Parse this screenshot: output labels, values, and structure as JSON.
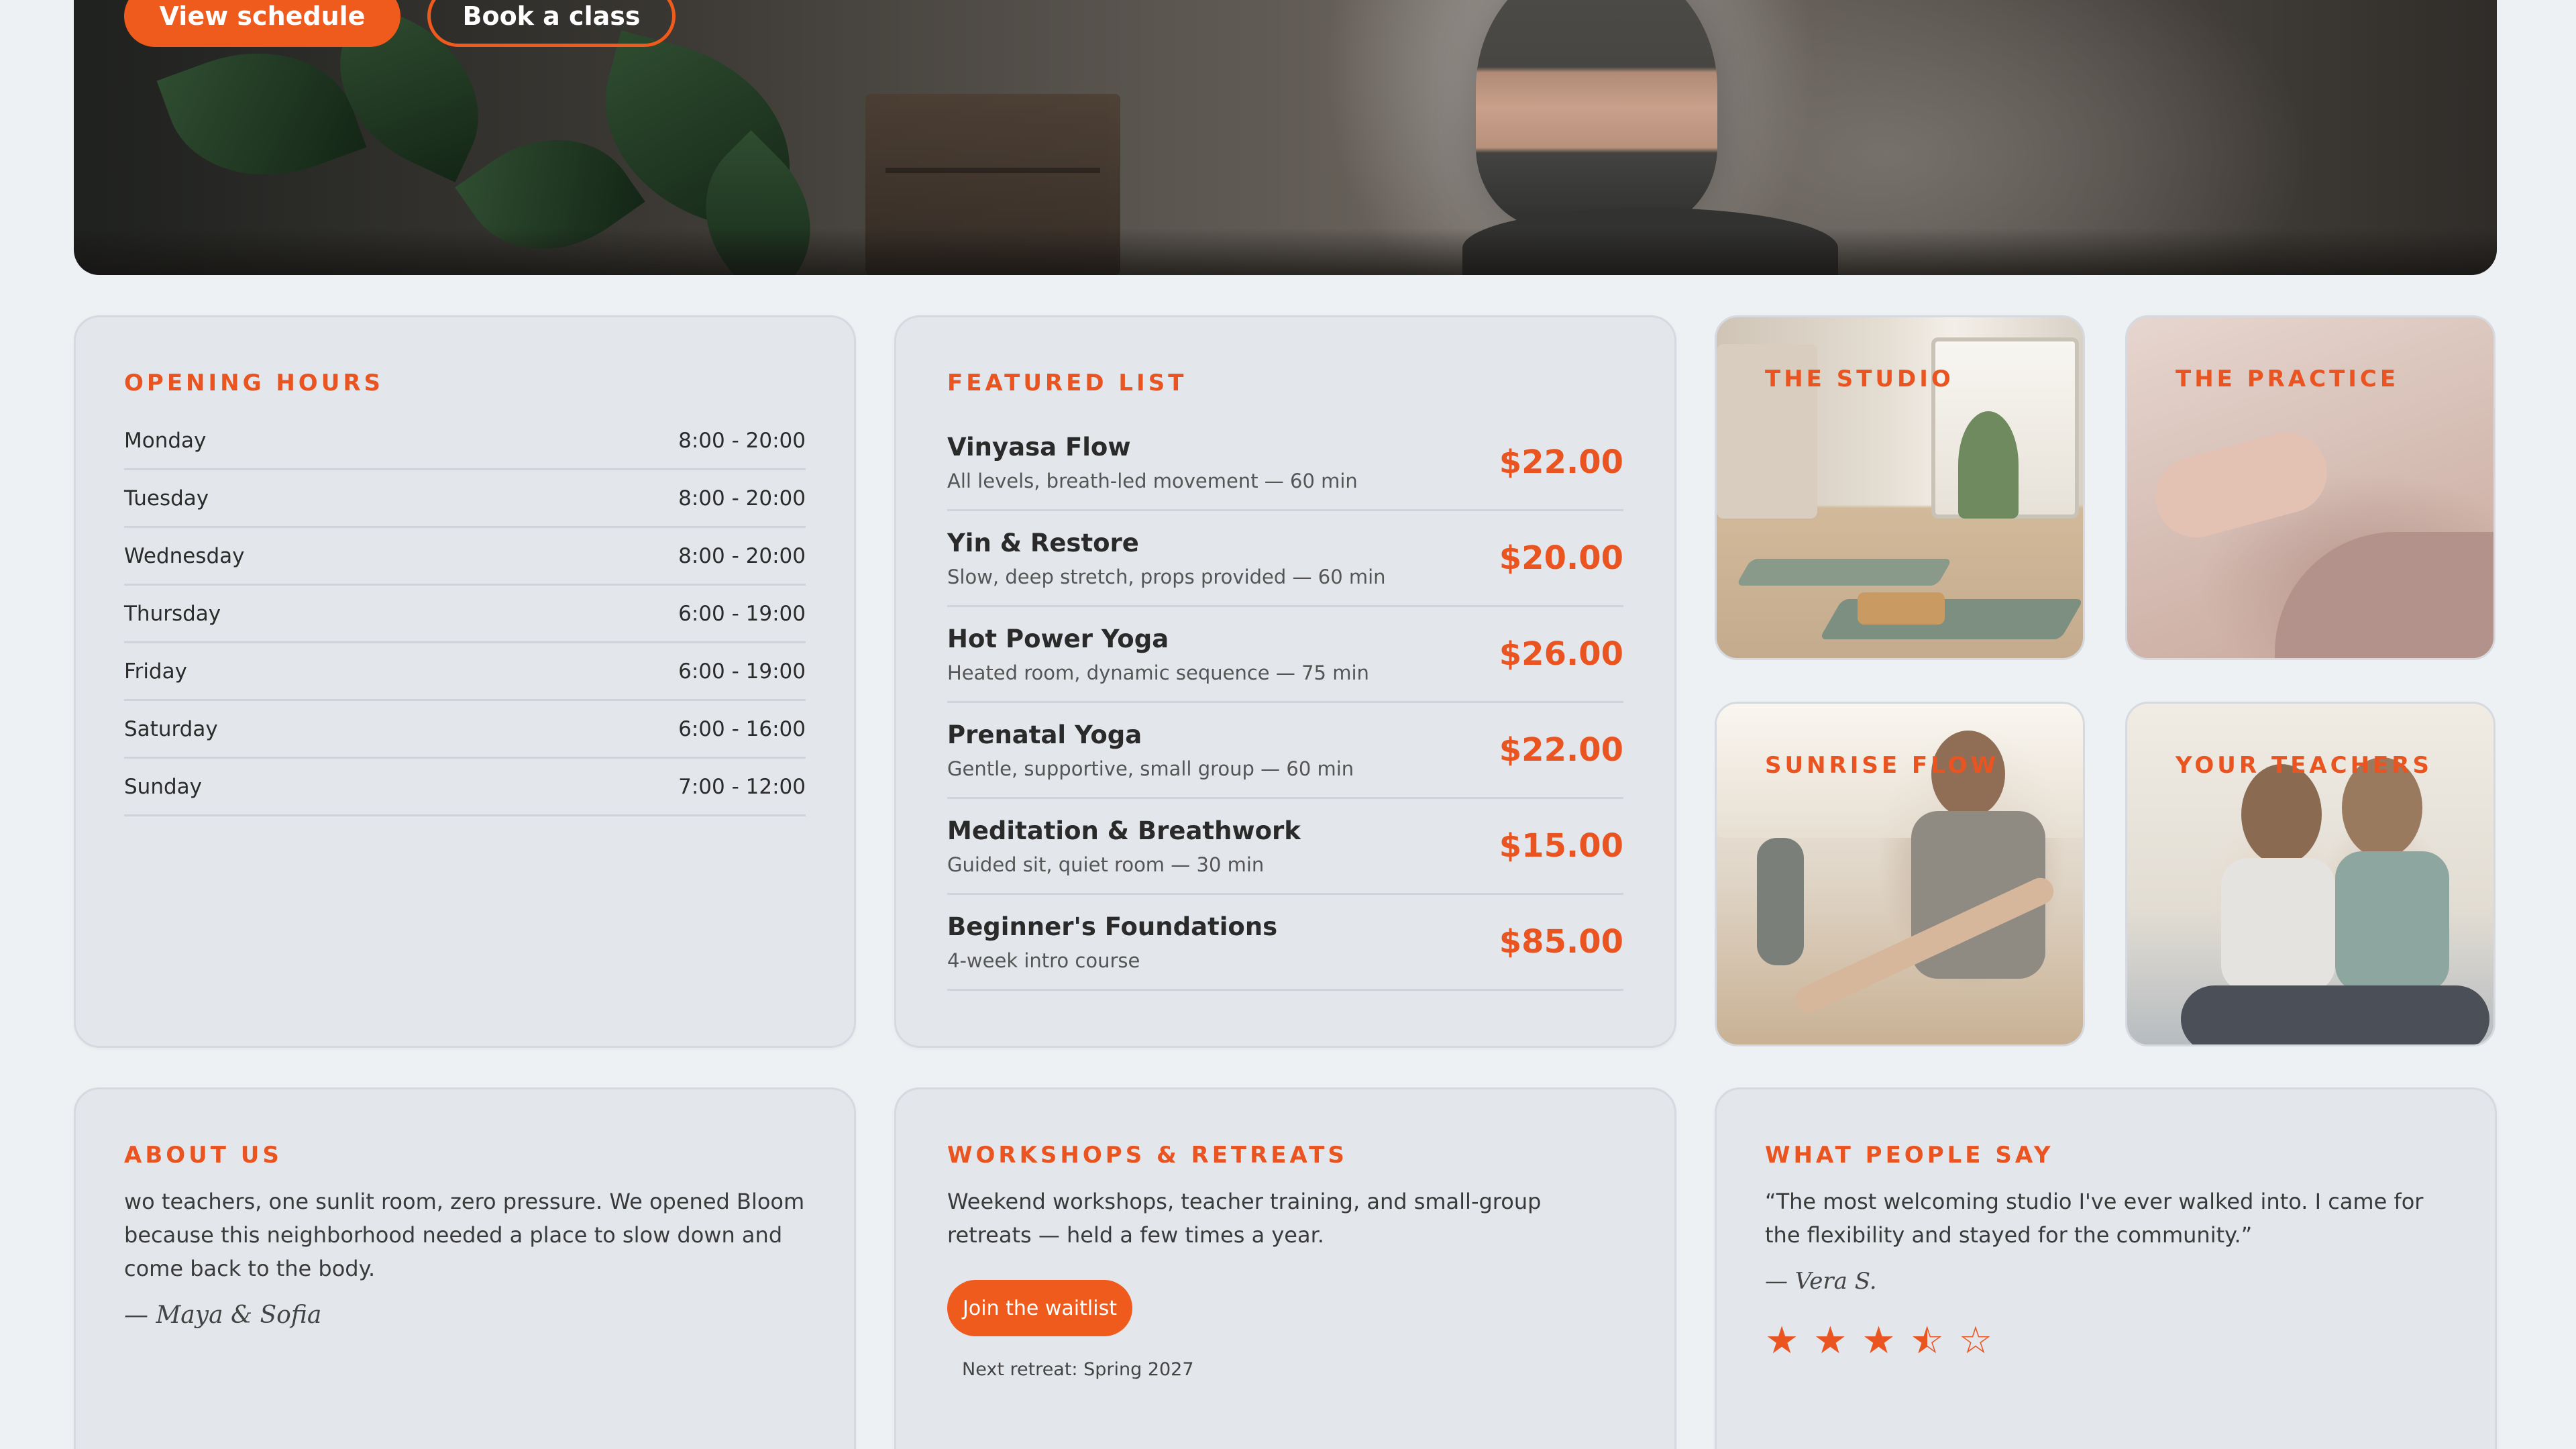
{
  "hero": {
    "primary_button": "View schedule",
    "secondary_button": "Book a class"
  },
  "opening_hours": {
    "title": "OPENING HOURS",
    "rows": [
      {
        "day": "Monday",
        "time": "8:00 - 20:00"
      },
      {
        "day": "Tuesday",
        "time": "8:00 - 20:00"
      },
      {
        "day": "Wednesday",
        "time": "8:00 - 20:00"
      },
      {
        "day": "Thursday",
        "time": "6:00 - 19:00"
      },
      {
        "day": "Friday",
        "time": "6:00 - 19:00"
      },
      {
        "day": "Saturday",
        "time": "6:00 - 16:00"
      },
      {
        "day": "Sunday",
        "time": "7:00 - 12:00"
      }
    ]
  },
  "featured": {
    "title": "FEATURED LIST",
    "items": [
      {
        "name": "Vinyasa Flow",
        "desc": "All levels, breath-led movement — 60 min",
        "price": "$22.00"
      },
      {
        "name": "Yin & Restore",
        "desc": "Slow, deep stretch, props provided — 60 min",
        "price": "$20.00"
      },
      {
        "name": "Hot Power Yoga",
        "desc": "Heated room, dynamic sequence — 75 min",
        "price": "$26.00"
      },
      {
        "name": "Prenatal Yoga",
        "desc": "Gentle, supportive, small group — 60 min",
        "price": "$22.00"
      },
      {
        "name": "Meditation & Breathwork",
        "desc": "Guided sit, quiet room — 30 min",
        "price": "$15.00"
      },
      {
        "name": "Beginner's Foundations",
        "desc": "4-week intro course",
        "price": "$85.00"
      }
    ]
  },
  "tiles": {
    "studio": "THE STUDIO",
    "practice": "THE PRACTICE",
    "sunrise": "SUNRISE FLOW",
    "teachers": "YOUR TEACHERS"
  },
  "about": {
    "title": "ABOUT US",
    "text": "wo teachers, one sunlit room, zero pressure. We opened Bloom because this neighborhood needed a place to slow down and come back to the body.",
    "signature": "— Maya & Sofia"
  },
  "workshops": {
    "title": "WORKSHOPS & RETREATS",
    "text": "Weekend workshops, teacher training, and small-group retreats — held a few times a year.",
    "button": "Join the waitlist",
    "note": "Next retreat: Spring 2027"
  },
  "reviews": {
    "title": "WHAT PEOPLE SAY",
    "quote": "“The most welcoming studio I've ever walked into. I came for the flexibility and stayed for the community.”",
    "author": "— Vera S.",
    "rating": 3.5,
    "rating_max": 5,
    "star_color": "#e95420"
  },
  "colors": {
    "accent": "#ef5a1d",
    "card_bg": "#e3e6eb",
    "page_bg": "#eef1f4"
  }
}
